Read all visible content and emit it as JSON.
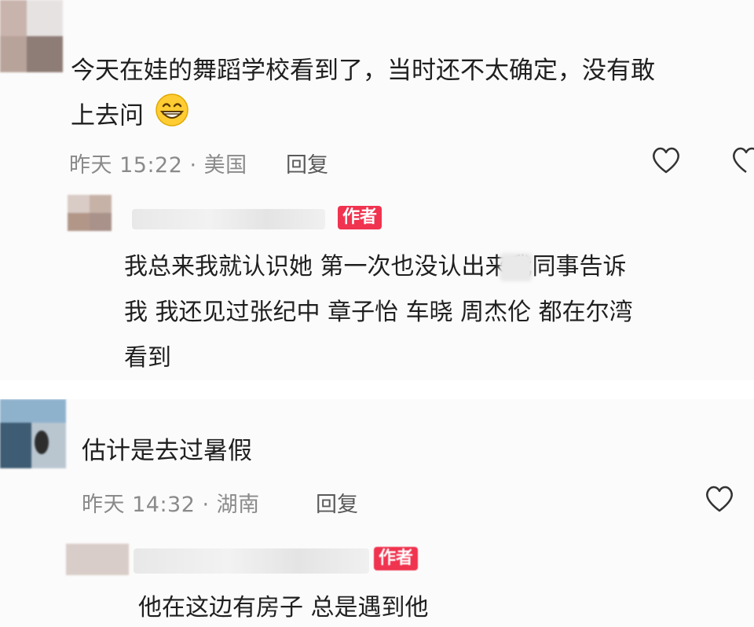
{
  "comment1": {
    "text_line1": "今天在娃的舞蹈学校看到了，当时还不太确定，没有敢",
    "text_line2": "上去问",
    "emoji": "grinning-face-emoji",
    "meta": "昨天 15:22 · 美国",
    "reply_label": "回复",
    "reply": {
      "badge": "作者",
      "line1": "我总来我就认识她 第一次也没认出来我同事告诉",
      "line2": "我 我还见过张纪中 章子怡 车晓 周杰伦 都在尔湾",
      "line3": "看到"
    }
  },
  "comment2": {
    "text": "估计是去过暑假",
    "meta": "昨天 14:32 · 湖南",
    "reply_label": "回复",
    "reply": {
      "badge": "作者",
      "line1": "他在这边有房子 总是遇到他"
    }
  },
  "colors": {
    "author_badge": "#f0334f",
    "meta_gray": "#8a8a8a",
    "background": "#fbfbfb"
  }
}
